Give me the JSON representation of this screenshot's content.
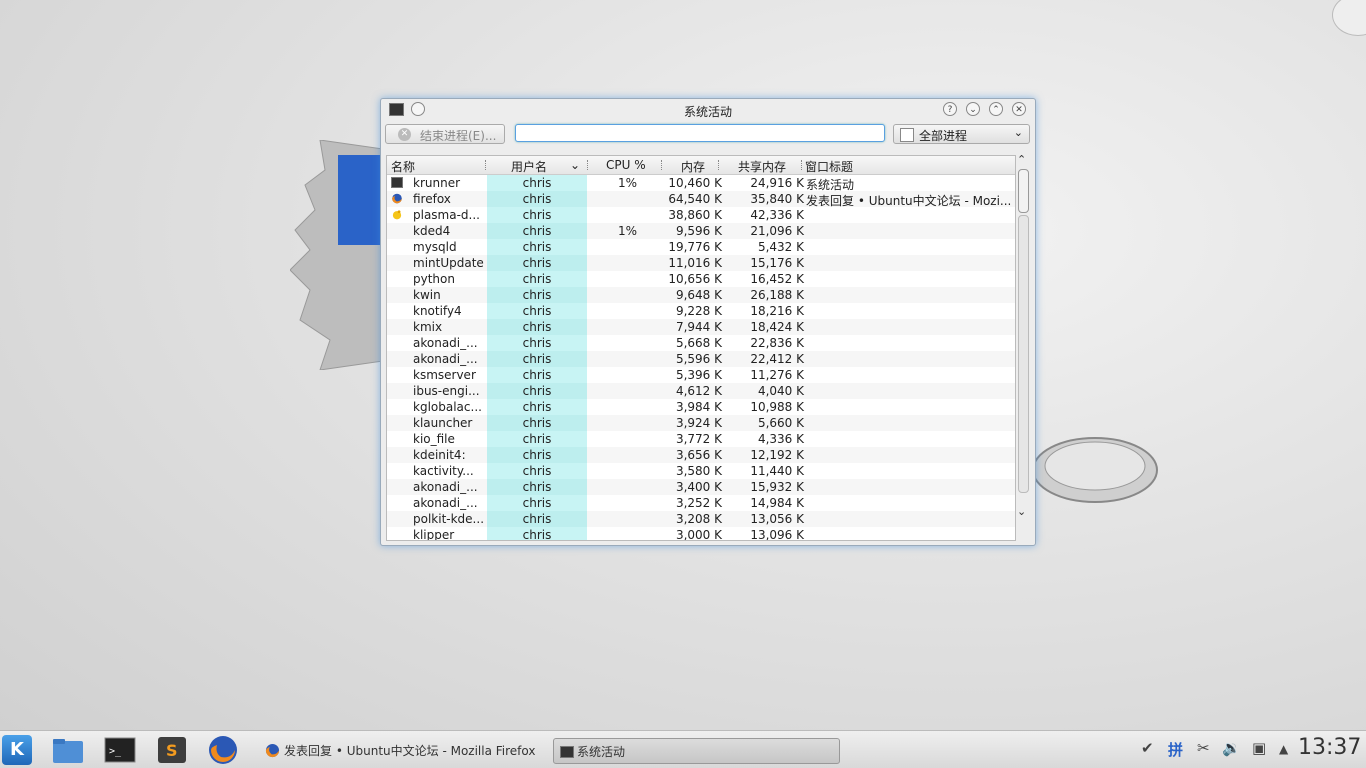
{
  "window": {
    "title": "系统活动",
    "kill_button": "结束进程(E)...",
    "search_value": "",
    "filter": "全部进程"
  },
  "columns": [
    "名称",
    "用户名",
    "CPU %",
    "内存",
    "共享内存",
    "窗口标题"
  ],
  "processes": [
    {
      "name": "krunner",
      "user": "chris",
      "cpu": "1%",
      "mem": "10,460 K",
      "shared": "24,916 K",
      "window": "系统活动",
      "icon": "terminal-icon"
    },
    {
      "name": "firefox",
      "user": "chris",
      "cpu": "",
      "mem": "64,540 K",
      "shared": "35,840 K",
      "window": "发表回复 • Ubuntu中文论坛 - Mozi...",
      "icon": "firefox-icon"
    },
    {
      "name": "plasma-d...",
      "user": "chris",
      "cpu": "",
      "mem": "38,860 K",
      "shared": "42,336 K",
      "window": "",
      "icon": "plasma-icon"
    },
    {
      "name": "kded4",
      "user": "chris",
      "cpu": "1%",
      "mem": "9,596 K",
      "shared": "21,096 K",
      "window": ""
    },
    {
      "name": "mysqld",
      "user": "chris",
      "cpu": "",
      "mem": "19,776 K",
      "shared": "5,432 K",
      "window": ""
    },
    {
      "name": "mintUpdate",
      "user": "chris",
      "cpu": "",
      "mem": "11,016 K",
      "shared": "15,176 K",
      "window": ""
    },
    {
      "name": "python",
      "user": "chris",
      "cpu": "",
      "mem": "10,656 K",
      "shared": "16,452 K",
      "window": ""
    },
    {
      "name": "kwin",
      "user": "chris",
      "cpu": "",
      "mem": "9,648 K",
      "shared": "26,188 K",
      "window": ""
    },
    {
      "name": "knotify4",
      "user": "chris",
      "cpu": "",
      "mem": "9,228 K",
      "shared": "18,216 K",
      "window": ""
    },
    {
      "name": "kmix",
      "user": "chris",
      "cpu": "",
      "mem": "7,944 K",
      "shared": "18,424 K",
      "window": ""
    },
    {
      "name": "akonadi_...",
      "user": "chris",
      "cpu": "",
      "mem": "5,668 K",
      "shared": "22,836 K",
      "window": ""
    },
    {
      "name": "akonadi_...",
      "user": "chris",
      "cpu": "",
      "mem": "5,596 K",
      "shared": "22,412 K",
      "window": ""
    },
    {
      "name": "ksmserver",
      "user": "chris",
      "cpu": "",
      "mem": "5,396 K",
      "shared": "11,276 K",
      "window": ""
    },
    {
      "name": "ibus-engi...",
      "user": "chris",
      "cpu": "",
      "mem": "4,612 K",
      "shared": "4,040 K",
      "window": ""
    },
    {
      "name": "kglobalac...",
      "user": "chris",
      "cpu": "",
      "mem": "3,984 K",
      "shared": "10,988 K",
      "window": ""
    },
    {
      "name": "klauncher",
      "user": "chris",
      "cpu": "",
      "mem": "3,924 K",
      "shared": "5,660 K",
      "window": ""
    },
    {
      "name": "kio_file",
      "user": "chris",
      "cpu": "",
      "mem": "3,772 K",
      "shared": "4,336 K",
      "window": ""
    },
    {
      "name": "kdeinit4:",
      "user": "chris",
      "cpu": "",
      "mem": "3,656 K",
      "shared": "12,192 K",
      "window": ""
    },
    {
      "name": "kactivity...",
      "user": "chris",
      "cpu": "",
      "mem": "3,580 K",
      "shared": "11,440 K",
      "window": ""
    },
    {
      "name": "akonadi_...",
      "user": "chris",
      "cpu": "",
      "mem": "3,400 K",
      "shared": "15,932 K",
      "window": ""
    },
    {
      "name": "akonadi_...",
      "user": "chris",
      "cpu": "",
      "mem": "3,252 K",
      "shared": "14,984 K",
      "window": ""
    },
    {
      "name": "polkit-kde...",
      "user": "chris",
      "cpu": "",
      "mem": "3,208 K",
      "shared": "13,056 K",
      "window": ""
    },
    {
      "name": "klipper",
      "user": "chris",
      "cpu": "",
      "mem": "3,000 K",
      "shared": "13,096 K",
      "window": ""
    }
  ],
  "taskbar": {
    "tasks": [
      {
        "label": "发表回复 • Ubuntu中文论坛 - Mozilla Firefox",
        "icon": "firefox-icon"
      },
      {
        "label": "系统活动",
        "icon": "terminal-icon"
      }
    ],
    "tray_input_method": "拼",
    "clock": "13:37",
    "launchers": [
      "kde-menu-icon",
      "folder-icon",
      "terminal-icon",
      "sublime-icon",
      "firefox-icon"
    ]
  },
  "colors": {
    "accent": "#3c8cdc",
    "user_column": "#c8f4f4"
  }
}
